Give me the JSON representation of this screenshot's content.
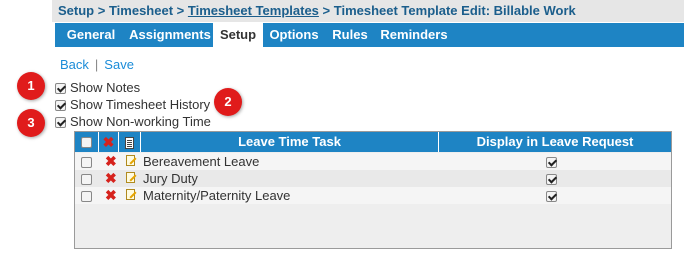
{
  "breadcrumb": {
    "items": [
      "Setup",
      "Timesheet",
      "Timesheet Templates",
      "Timesheet Template Edit: Billable Work"
    ],
    "separator": ">"
  },
  "tabs": [
    {
      "label": "General",
      "active": false
    },
    {
      "label": "Assignments",
      "active": false
    },
    {
      "label": "Setup",
      "active": true
    },
    {
      "label": "Options",
      "active": false
    },
    {
      "label": "Rules",
      "active": false
    },
    {
      "label": "Reminders",
      "active": false
    }
  ],
  "actions": {
    "back": "Back",
    "save": "Save",
    "separator": "|"
  },
  "options": [
    {
      "label": "Show Notes",
      "checked": true
    },
    {
      "label": "Show Timesheet History",
      "checked": true
    },
    {
      "label": "Show Non-working Time",
      "checked": true
    }
  ],
  "badges": [
    "1",
    "2",
    "3"
  ],
  "grid": {
    "columns": {
      "task": "Leave Time Task",
      "display": "Display in Leave Request"
    },
    "rows": [
      {
        "task": "Bereavement Leave",
        "display": true
      },
      {
        "task": "Jury Duty",
        "display": true
      },
      {
        "task": "Maternity/Paternity Leave",
        "display": true
      }
    ]
  },
  "colors": {
    "accent": "#1e84c4",
    "link": "#1b8cd8",
    "badge": "#e01b1b"
  }
}
